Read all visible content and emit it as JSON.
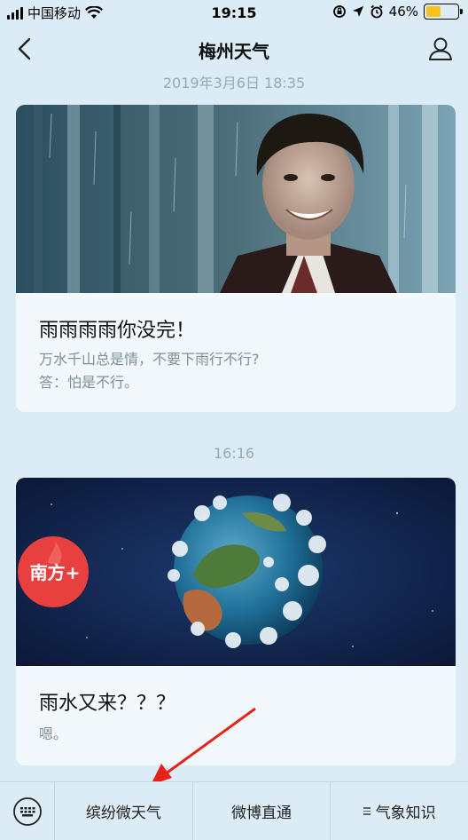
{
  "status_bar": {
    "carrier": "中国移动",
    "time": "19:15",
    "battery_pct": "46%",
    "battery_level": 0.46
  },
  "nav": {
    "title": "梅州天气"
  },
  "messages": [
    {
      "timestamp": "2019年3月6日 18:35",
      "title": "雨雨雨雨你没完！",
      "desc_lines": [
        "万水千山总是情，不要下雨行不行?",
        "答：怕是不行。"
      ]
    },
    {
      "timestamp": "16:16",
      "title": "雨水又来？？？",
      "desc_lines": [
        "嗯。"
      ],
      "badge_text": "南方+"
    }
  ],
  "bottom_menu": {
    "items": [
      "缤纷微天气",
      "微博直通",
      "气象知识"
    ]
  },
  "colors": {
    "background": "#dcecf6",
    "card": "#f2f8fc",
    "arrow": "#e8221b",
    "badge": "#e8403f"
  }
}
